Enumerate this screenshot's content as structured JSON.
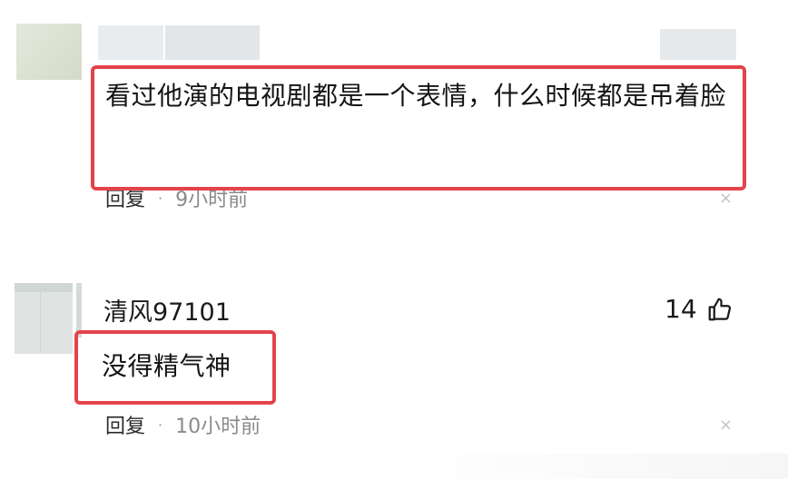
{
  "comments": [
    {
      "text": "看过他演的电视剧都是一个表情，什么时候都是吊着脸",
      "reply_label": "回复",
      "separator": "·",
      "time": "9小时前",
      "close_symbol": "×"
    },
    {
      "username": "清风97101",
      "like_count": "14",
      "text": "没得精气神",
      "reply_label": "回复",
      "separator": "·",
      "time": "10小时前",
      "close_symbol": "×"
    }
  ],
  "colors": {
    "highlight": "#e3434a",
    "text": "#1a1a1a",
    "muted": "#8a8a8a"
  },
  "icons": {
    "like": "thumbs-up-icon",
    "close": "close-icon"
  }
}
